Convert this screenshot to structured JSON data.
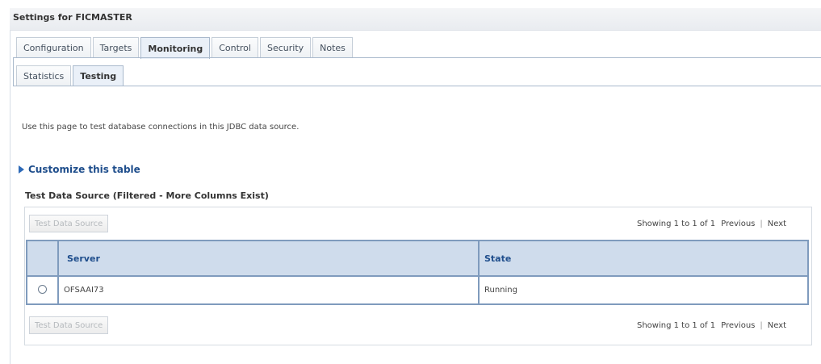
{
  "header": {
    "title": "Settings for FICMASTER"
  },
  "tabs": [
    {
      "label": "Configuration",
      "active": false
    },
    {
      "label": "Targets",
      "active": false
    },
    {
      "label": "Monitoring",
      "active": true
    },
    {
      "label": "Control",
      "active": false
    },
    {
      "label": "Security",
      "active": false
    },
    {
      "label": "Notes",
      "active": false
    }
  ],
  "subtabs": [
    {
      "label": "Statistics",
      "active": false
    },
    {
      "label": "Testing",
      "active": true
    }
  ],
  "main": {
    "description": "Use this page to test database connections in this JDBC data source.",
    "customize_link": "Customize this table",
    "table_title": "Test Data Source (Filtered - More Columns Exist)",
    "button_label": "Test Data Source",
    "pager": {
      "summary": "Showing 1 to 1 of 1",
      "previous": "Previous",
      "separator": "|",
      "next": "Next"
    },
    "columns": [
      "Server",
      "State"
    ],
    "rows": [
      {
        "server": "OFSAAI73",
        "state": "Running",
        "selected": false
      }
    ]
  },
  "colors": {
    "accent": "#1f4e8c",
    "header_bg": "#cfdcec",
    "table_border": "#7f9bbd"
  },
  "icons": {
    "expand": "triangle-right-icon",
    "radio": "radio-button"
  }
}
